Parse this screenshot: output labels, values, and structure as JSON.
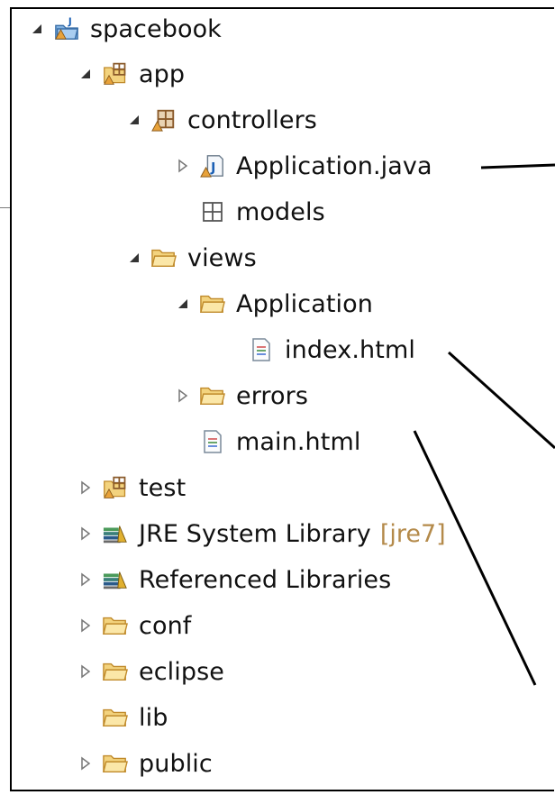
{
  "tree": {
    "root": {
      "label": "spacebook",
      "icon": "project-icon"
    },
    "items": [
      {
        "name": "app",
        "label": "app",
        "icon": "source-folder-icon",
        "twisty": "expanded"
      },
      {
        "name": "controllers",
        "label": "controllers",
        "icon": "package-icon",
        "twisty": "expanded"
      },
      {
        "name": "application-java",
        "label": "Application.java",
        "icon": "java-file-icon",
        "twisty": "collapsed"
      },
      {
        "name": "models",
        "label": "models",
        "icon": "empty-package-icon",
        "twisty": "none"
      },
      {
        "name": "views",
        "label": "views",
        "icon": "folder-icon",
        "twisty": "expanded"
      },
      {
        "name": "application-folder",
        "label": "Application",
        "icon": "folder-icon",
        "twisty": "expanded"
      },
      {
        "name": "index-html",
        "label": "index.html",
        "icon": "html-file-icon",
        "twisty": "none"
      },
      {
        "name": "errors",
        "label": "errors",
        "icon": "folder-icon",
        "twisty": "collapsed"
      },
      {
        "name": "main-html",
        "label": "main.html",
        "icon": "html-file-icon",
        "twisty": "none"
      },
      {
        "name": "test",
        "label": "test",
        "icon": "source-folder-icon",
        "twisty": "collapsed"
      },
      {
        "name": "jre-system-library",
        "label": "JRE System Library",
        "decoration": "[jre7]",
        "icon": "library-icon",
        "twisty": "collapsed"
      },
      {
        "name": "referenced-libraries",
        "label": "Referenced Libraries",
        "icon": "library-icon",
        "twisty": "collapsed"
      },
      {
        "name": "conf",
        "label": "conf",
        "icon": "folder-icon",
        "twisty": "collapsed"
      },
      {
        "name": "eclipse",
        "label": "eclipse",
        "icon": "folder-icon",
        "twisty": "collapsed"
      },
      {
        "name": "lib",
        "label": "lib",
        "icon": "folder-icon",
        "twisty": "none"
      },
      {
        "name": "public",
        "label": "public",
        "icon": "folder-icon",
        "twisty": "collapsed"
      }
    ]
  },
  "colors": {
    "folder": "#f3d37e",
    "folder_stroke": "#c08a2a",
    "package": "#8a5a2a",
    "library": "#3a7f7a",
    "warning": "#e8a23a"
  }
}
